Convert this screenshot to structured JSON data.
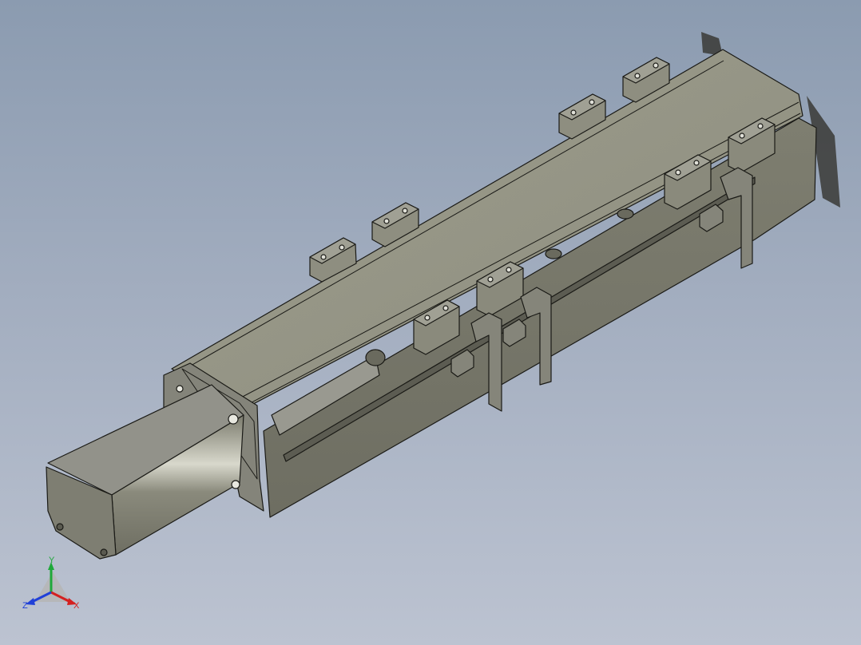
{
  "viewport": {
    "background_top": "#8b9bb0",
    "background_bottom": "#bcc3d1"
  },
  "model": {
    "body_color": "#88887a",
    "edge_color": "#1a1a16"
  },
  "triad": {
    "x_label": "X",
    "y_label": "Y",
    "z_label": "Z",
    "x_color": "#d42020",
    "y_color": "#1fa83a",
    "z_color": "#2040d8"
  }
}
